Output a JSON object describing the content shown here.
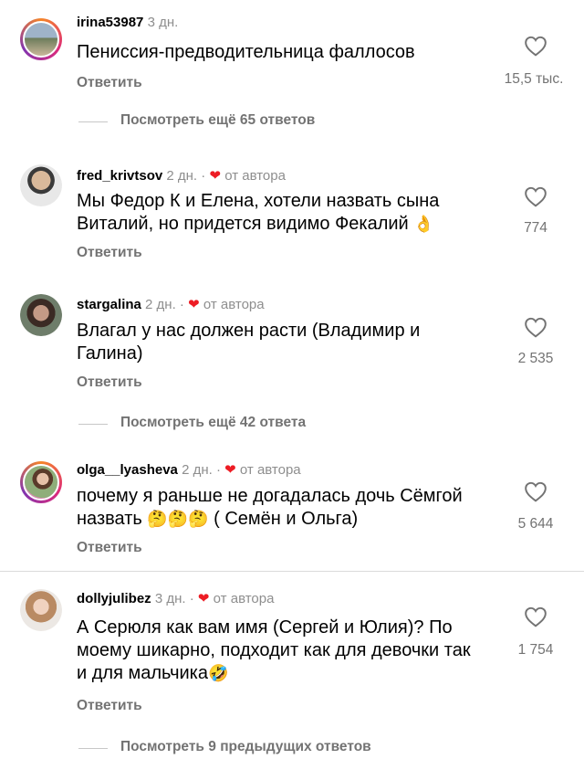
{
  "comments": [
    {
      "username": "irina53987",
      "time": "3 дн.",
      "text": "Пенисcия-предводительница фаллосов",
      "reply": "Ответить",
      "likes": "15,5 тыс.",
      "view_more": "Посмотреть ещё 65 ответов"
    },
    {
      "username": "fred_krivtsov",
      "time": "2 дн. ·",
      "author_badge": "от автора",
      "text": "Мы Федор К и Елена, хотели назвать сына Виталий, но придется видимо Фекалий",
      "emoji": "👌",
      "reply": "Ответить",
      "likes": "774"
    },
    {
      "username": "stargalina",
      "time": "2 дн. ·",
      "author_badge": "от автора",
      "text": "Влагал у нас  должен расти (Владимир и Галина)",
      "reply": "Ответить",
      "likes": "2 535",
      "view_more": "Посмотреть ещё 42 ответа"
    },
    {
      "username": "olga__lyasheva",
      "time": "2 дн. ·",
      "author_badge": "от автора",
      "text_1": "почему я раньше не догадалась дочь Сёмгой назвать",
      "emoji": "🤔🤔🤔",
      "text_2": " ( Семён и Ольга)",
      "reply": "Ответить",
      "likes": "5 644"
    },
    {
      "username": "dollyjulibez",
      "time": "3 дн. ·",
      "author_badge": "от автора",
      "text": "А Серюля как вам имя (Сергей и Юлия)? По моему шикарно, подходит как для девочки так и для мальчика",
      "emoji": "🤣",
      "reply": "Ответить",
      "likes": "1 754",
      "view_more": "Посмотреть 9 предыдущих ответов"
    }
  ],
  "icons": {
    "like": "heart-outline-icon",
    "author_like": "heart-filled-icon"
  },
  "colors": {
    "author_heart": "#ed1c24",
    "muted_text": "#737373",
    "story_ring": "#dd2a7b"
  }
}
